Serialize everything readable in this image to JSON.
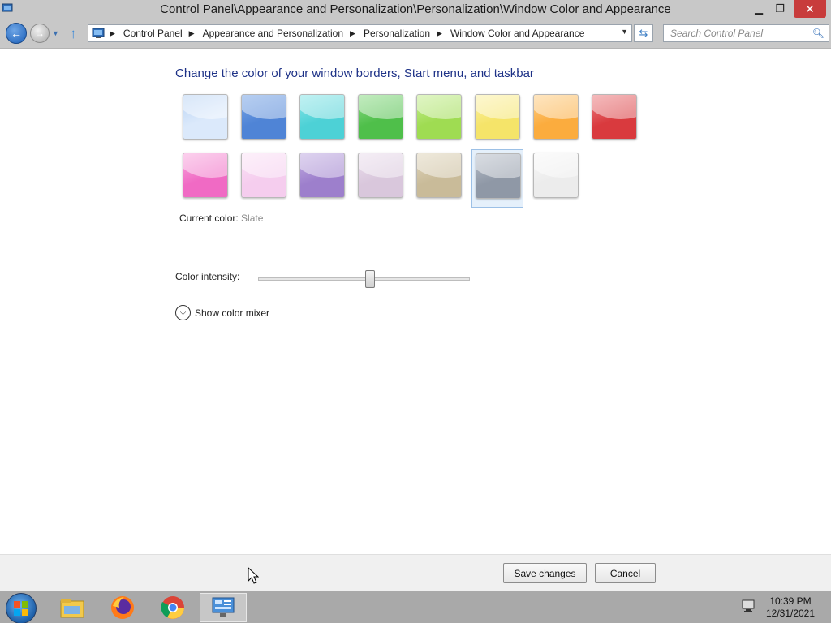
{
  "window": {
    "title": "Control Panel\\Appearance and Personalization\\Personalization\\Window Color and Appearance",
    "min_icon": "minimize-icon",
    "max_icon": "restore-icon",
    "close_icon": "close-icon"
  },
  "address": {
    "crumbs": [
      "Control Panel",
      "Appearance and Personalization",
      "Personalization",
      "Window Color and Appearance"
    ],
    "search_placeholder": "Search Control Panel"
  },
  "content": {
    "heading": "Change the color of your window borders, Start menu, and taskbar",
    "current_color_label": "Current color:",
    "current_color_value": "Slate",
    "intensity_label": "Color intensity:",
    "intensity_value": 0.53,
    "mixer_label": "Show color mixer"
  },
  "swatches": [
    {
      "color": "#dbe9fb",
      "accent": "#b9d3f3"
    },
    {
      "color": "#4f84d6",
      "accent": "#7aa6e6"
    },
    {
      "color": "#4dd1d6",
      "accent": "#8be6e8"
    },
    {
      "color": "#4fbf4a",
      "accent": "#8fdc89"
    },
    {
      "color": "#9fdc52",
      "accent": "#c6ee93"
    },
    {
      "color": "#f5e469",
      "accent": "#fbf1a8"
    },
    {
      "color": "#fbac3e",
      "accent": "#fdd08a"
    },
    {
      "color": "#d93a3e",
      "accent": "#ec8184"
    },
    {
      "color": "#f06ac4",
      "accent": "#f8a9de"
    },
    {
      "color": "#f5cdee",
      "accent": "#fae3f6"
    },
    {
      "color": "#9d7fcc",
      "accent": "#c2aee2"
    },
    {
      "color": "#d9c7dc",
      "accent": "#ebdfed"
    },
    {
      "color": "#c9bb99",
      "accent": "#e0d6bd"
    },
    {
      "color": "#8f98a6",
      "accent": "#b8bfca"
    },
    {
      "color": "#ececec",
      "accent": "#f8f8f8"
    }
  ],
  "selected_swatch_index": 13,
  "buttons": {
    "save": "Save changes",
    "cancel": "Cancel"
  },
  "taskbar": {
    "items": [
      {
        "name": "file-explorer-icon",
        "color": "#f2c94c"
      },
      {
        "name": "firefox-icon",
        "color": "#ff7a18"
      },
      {
        "name": "chrome-icon",
        "color": "#db4437"
      },
      {
        "name": "control-panel-icon",
        "color": "#4a90d9",
        "active": true
      }
    ],
    "time": "10:39 PM",
    "date": "12/31/2021"
  }
}
